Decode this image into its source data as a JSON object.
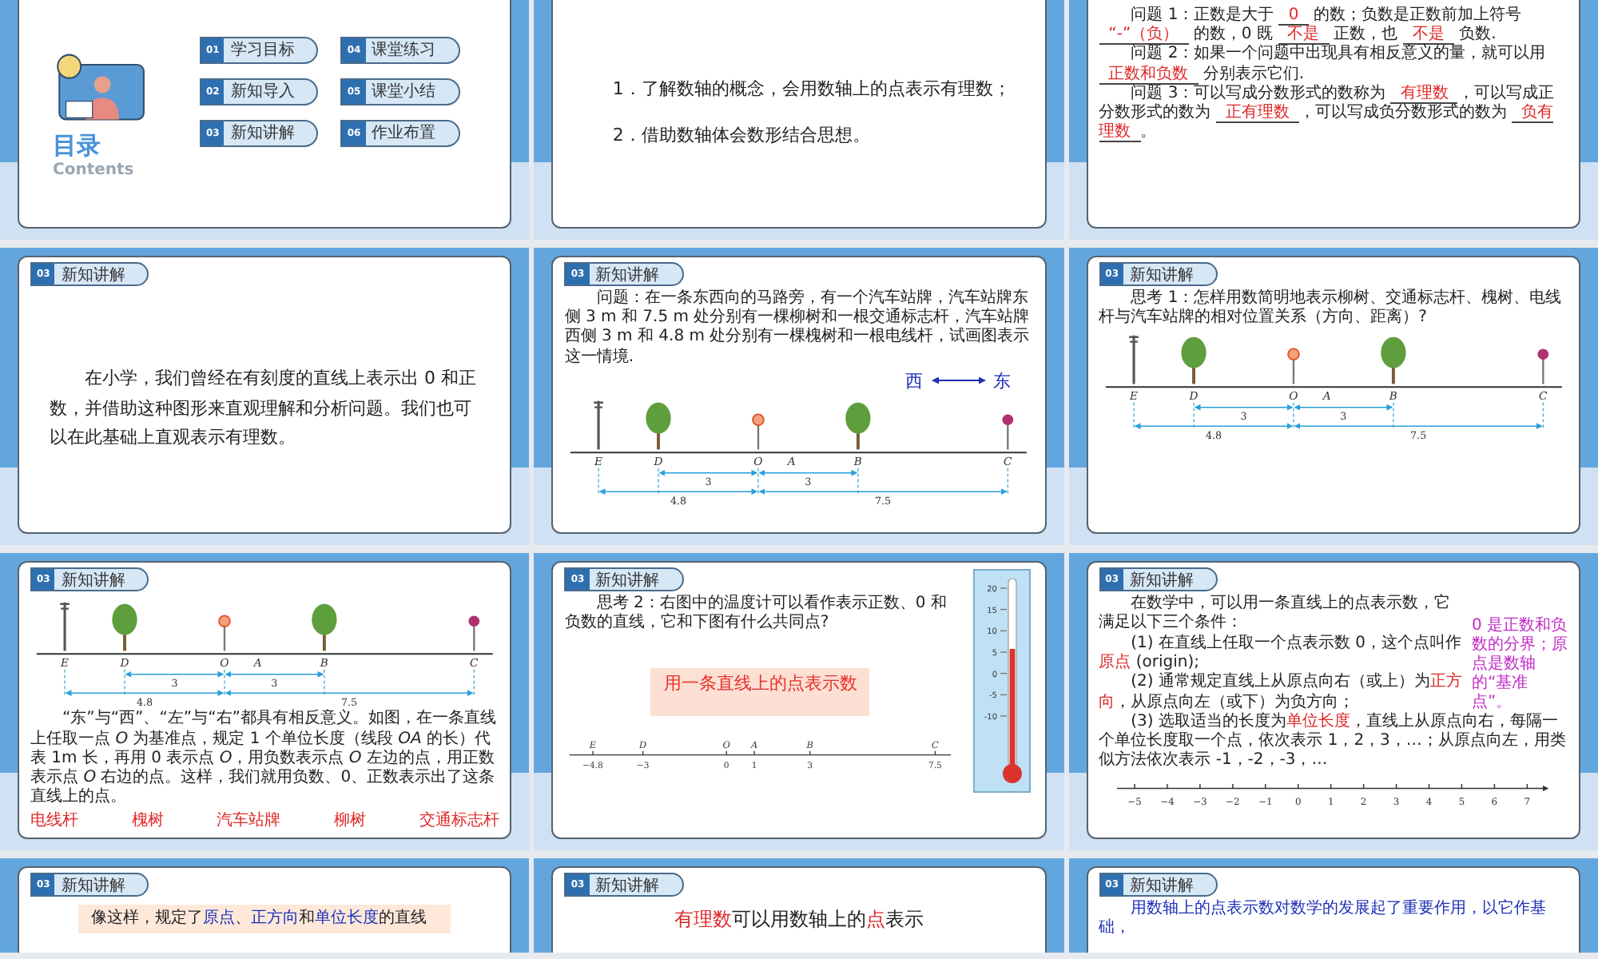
{
  "slides": [
    {
      "kind": "toc",
      "title": "目录",
      "subtitle": "Contents",
      "items": [
        {
          "number": "01",
          "label": "学习目标"
        },
        {
          "number": "02",
          "label": "新知导入"
        },
        {
          "number": "03",
          "label": "新知讲解"
        },
        {
          "number": "04",
          "label": "课堂练习"
        },
        {
          "number": "05",
          "label": "课堂小结"
        },
        {
          "number": "06",
          "label": "作业布置"
        }
      ]
    },
    {
      "kind": "statement",
      "blocks": [
        {
          "kind": "paragraph",
          "text": "1．了解数轴的概念，会用数轴上的点表示有理数；"
        },
        {
          "kind": "paragraph",
          "text": "2．借助数轴体会数形结合思想。"
        }
      ]
    },
    {
      "kind": "content",
      "blocks": [
        {
          "kind": "paragraph",
          "segments": [
            {
              "text": "问题 1：正数是大于 "
            },
            {
              "text": "0",
              "blank": true
            },
            {
              "text": " 的数；负数是正数前加上符号 "
            },
            {
              "text": "“-”（负）",
              "blank": true
            },
            {
              "text": " 的数，0 既 "
            },
            {
              "text": "不是",
              "blank": true
            },
            {
              "text": " 正数，也 "
            },
            {
              "text": "不是",
              "blank": true
            },
            {
              "text": " 负数."
            }
          ]
        },
        {
          "kind": "paragraph",
          "segments": [
            {
              "text": "问题 2：如果一个问题中出现具有相反意义的量，就可以用 "
            },
            {
              "text": "正数和负数",
              "blank": true
            },
            {
              "text": " 分别表示它们."
            }
          ]
        },
        {
          "kind": "paragraph",
          "segments": [
            {
              "text": "问题 3：可以写成分数形式的数称为 "
            },
            {
              "text": "有理数",
              "blank": true
            },
            {
              "text": "，可以写成正分数形式的数为 "
            },
            {
              "text": "正有理数",
              "blank": true
            },
            {
              "text": "，可以写成负分数形式的数为 "
            },
            {
              "text": "负有理数",
              "blank": true
            },
            {
              "text": "。"
            }
          ]
        }
      ]
    },
    {
      "kind": "statement",
      "section": {
        "number": "03",
        "label": "新知讲解"
      },
      "blocks": [
        {
          "kind": "paragraph",
          "text": "在小学，我们曾经在有刻度的直线上表示出 0 和正数，并借助这种图形来直观理解和分析问题。我们也可以在此基础上直观表示有理数。"
        }
      ]
    },
    {
      "kind": "content",
      "section": {
        "number": "03",
        "label": "新知讲解"
      },
      "blocks": [
        {
          "kind": "paragraph",
          "text": "问题：在一条东西向的马路旁，有一个汽车站牌，汽车站牌东侧 3 m 和 7.5 m 处分别有一棵柳树和一根交通标志杆，汽车站牌西侧 3 m 和 4.8 m 处分别有一棵槐树和一根电线杆，试画图表示这一情境."
        },
        {
          "kind": "direction",
          "labels": [
            "西",
            "东"
          ]
        },
        {
          "kind": "diagram",
          "points": [
            "E",
            "D",
            "O",
            "A",
            "B",
            "C"
          ],
          "spans": [
            "3",
            "3",
            "4.8",
            "7.5"
          ]
        }
      ]
    },
    {
      "kind": "content",
      "section": {
        "number": "03",
        "label": "新知讲解"
      },
      "blocks": [
        {
          "kind": "paragraph",
          "text": "思考 1：怎样用数简明地表示柳树、交通标志杆、槐树、电线杆与汽车站牌的相对位置关系（方向、距离）?"
        },
        {
          "kind": "diagram",
          "points": [
            "E",
            "D",
            "O",
            "A",
            "B",
            "C"
          ],
          "spans": [
            "3",
            "3",
            "4.8",
            "7.5"
          ]
        }
      ]
    },
    {
      "kind": "content",
      "section": {
        "number": "03",
        "label": "新知讲解"
      },
      "blocks": [
        {
          "kind": "diagram",
          "points": [
            "E",
            "D",
            "O",
            "A",
            "B",
            "C"
          ],
          "spans": [
            "3",
            "3",
            "4.8",
            "7.5"
          ]
        },
        {
          "kind": "paragraph",
          "text": "“东”与“西”、“左”与“右”都具有相反意义。如图，在一条直线上任取一点 *O* 为基准点，规定 1 个单位长度（线段 *OA* 的长）代表 1m 长，再用 0 表示点 *O*，用负数表示点 *O* 左边的点，用正数表示点 *O* 右边的点。这样，我们就用负数、0、正数表示出了这条直线上的点。"
        },
        {
          "kind": "labels",
          "items": [
            "电线杆",
            "槐树",
            "汽车站牌",
            "柳树",
            "交通标志杆"
          ]
        }
      ]
    },
    {
      "kind": "content",
      "section": {
        "number": "03",
        "label": "新知讲解"
      },
      "blocks": [
        {
          "kind": "paragraph",
          "text": "思考 2：右图中的温度计可以看作表示正数、0 和负数的直线，它和下图有什么共同点?"
        },
        {
          "kind": "highlight",
          "text": "用一条直线上的点表示数"
        },
        {
          "kind": "scale",
          "points": [
            {
              "label": "E",
              "value": "−4.8"
            },
            {
              "label": "D",
              "value": "−3"
            },
            {
              "label": "O",
              "value": "0"
            },
            {
              "label": "A",
              "value": "1"
            },
            {
              "label": "B",
              "value": "3"
            },
            {
              "label": "C",
              "value": "7.5"
            }
          ]
        },
        {
          "kind": "thermometer",
          "labels": [
            "20",
            "15",
            "10",
            "5",
            "0",
            "-5",
            "-10"
          ]
        }
      ]
    },
    {
      "kind": "content",
      "section": {
        "number": "03",
        "label": "新知讲解"
      },
      "blocks": [
        {
          "kind": "paragraph",
          "text": "在数学中，可以用一条直线上的点表示数，它满足以下三个条件："
        },
        {
          "kind": "paragraph",
          "segments": [
            {
              "text": "(1) 在直线上任取一个点表示数 0，这个点叫作"
            },
            {
              "text": "原点",
              "color": "#e02828"
            },
            {
              "text": " (origin);"
            }
          ]
        },
        {
          "kind": "paragraph",
          "segments": [
            {
              "text": "(2) 通常规定直线上从原点向右（或上）为"
            },
            {
              "text": "正方向",
              "color": "#e02828"
            },
            {
              "text": "，从原点向左（或下）为负方向；"
            }
          ]
        },
        {
          "kind": "note",
          "text": "0 是正数和负数的分界；原点是数轴的“基准点”。"
        },
        {
          "kind": "paragraph",
          "segments": [
            {
              "text": "(3) 选取适当的长度为"
            },
            {
              "text": "单位长度",
              "color": "#e02828"
            },
            {
              "text": "，直线上从原点向右，每隔一个单位长度取一个点，依次表示 1，2，3，…；从原点向左，用类似方法依次表示 -1，-2，-3，…"
            }
          ]
        },
        {
          "kind": "ticks",
          "labels": [
            "−5",
            "−4",
            "−3",
            "−2",
            "−1",
            "0",
            "1",
            "2",
            "3",
            "4",
            "5",
            "6",
            "7"
          ]
        }
      ]
    },
    {
      "kind": "content",
      "section": {
        "number": "03",
        "label": "新知讲解"
      },
      "blocks": [
        {
          "kind": "paragraph",
          "boxed": true,
          "segments": [
            {
              "text": "像这样，规定了"
            },
            {
              "text": "原点",
              "color": "#1c2fb8"
            },
            {
              "text": "、"
            },
            {
              "text": "正方向",
              "color": "#1c2fb8"
            },
            {
              "text": "和"
            },
            {
              "text": "单位长度",
              "color": "#1c2fb8"
            },
            {
              "text": "的直线"
            }
          ]
        }
      ]
    },
    {
      "kind": "content",
      "section": {
        "number": "03",
        "label": "新知讲解"
      },
      "blocks": [
        {
          "kind": "heading",
          "segments": [
            {
              "text": "有理数",
              "color": "#e02828"
            },
            {
              "text": "可以用数轴上的"
            },
            {
              "text": "点",
              "color": "#e02828"
            },
            {
              "text": "表示"
            }
          ]
        }
      ]
    },
    {
      "kind": "content",
      "section": {
        "number": "03",
        "label": "新知讲解"
      },
      "blocks": [
        {
          "kind": "paragraph",
          "color": "#1c2fb8",
          "text": "用数轴上的点表示数对数学的发展起了重要作用，以它作基础，"
        }
      ]
    }
  ]
}
